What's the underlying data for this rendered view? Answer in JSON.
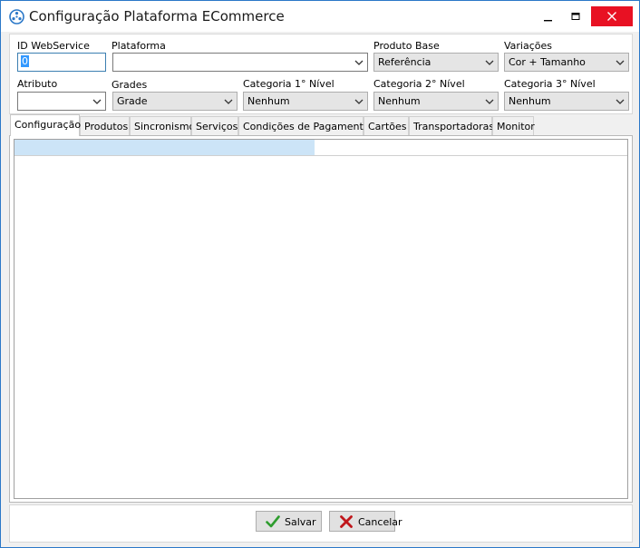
{
  "window": {
    "title": "Configuração Plataforma ECommerce",
    "accent_color": "#2b78c8",
    "close_color": "#e81123"
  },
  "fields": {
    "id_webservice": {
      "label": "ID WebService",
      "value": "0"
    },
    "plataforma": {
      "label": "Plataforma",
      "value": ""
    },
    "produto_base": {
      "label": "Produto Base",
      "value": "Referência"
    },
    "variacoes": {
      "label": "Variações",
      "value": "Cor + Tamanho"
    },
    "atributo": {
      "label": "Atributo",
      "value": ""
    },
    "grades": {
      "label": "Grades",
      "value": "Grade"
    },
    "categoria1": {
      "label": "Categoria 1° Nível",
      "value": "Nenhum"
    },
    "categoria2": {
      "label": "Categoria 2° Nível",
      "value": "Nenhum"
    },
    "categoria3": {
      "label": "Categoria 3° Nível",
      "value": "Nenhum"
    }
  },
  "tabs": [
    {
      "label": "Configuração",
      "active": true
    },
    {
      "label": "Produtos"
    },
    {
      "label": "Sincronismo"
    },
    {
      "label": "Serviços"
    },
    {
      "label": "Condições de Pagamentos"
    },
    {
      "label": "Cartões"
    },
    {
      "label": "Transportadoras"
    },
    {
      "label": "Monitor"
    }
  ],
  "progress": {
    "fraction": 0.49,
    "color": "#cce4f7"
  },
  "buttons": {
    "salvar": {
      "label": "Salvar",
      "icon": "check-icon",
      "icon_color": "#2e9d2e"
    },
    "cancelar": {
      "label": "Cancelar",
      "icon": "x-icon",
      "icon_color": "#c0161b"
    }
  }
}
